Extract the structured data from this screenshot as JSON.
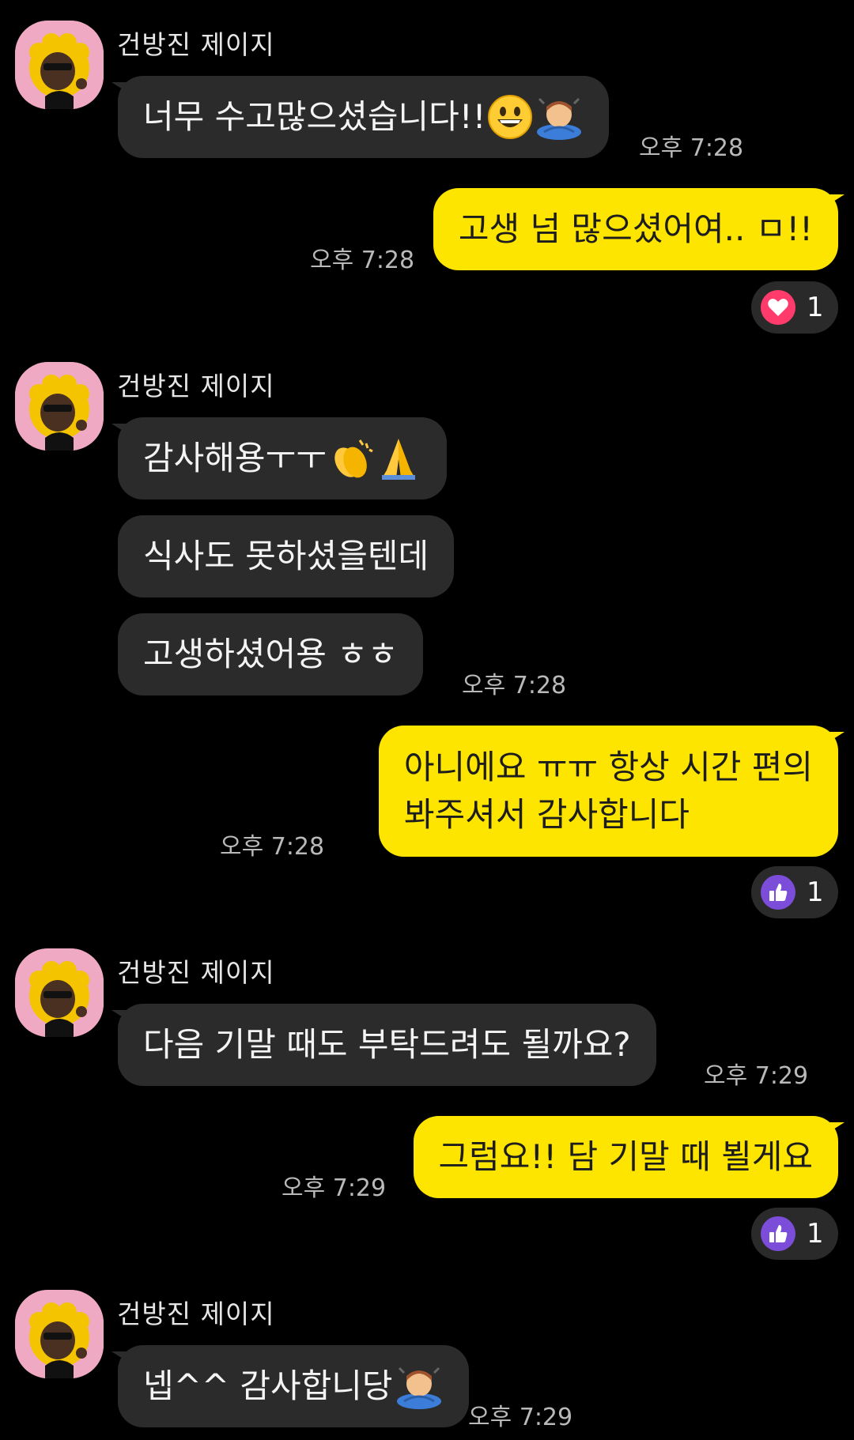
{
  "sender": {
    "name": "건방진 제이지",
    "avatar_bg": "#f0a9c2"
  },
  "colors": {
    "background": "#000000",
    "incoming_bubble": "#2b2b2b",
    "outgoing_bubble": "#fee500",
    "heart": "#ff3b6b",
    "like": "#7c4dd8"
  },
  "messages": [
    {
      "id": "m1",
      "text": "너무 수고많으셨습니다!!",
      "emojis": [
        "grinning-face",
        "person-bowing"
      ],
      "time": "오후 7:28"
    },
    {
      "id": "m2",
      "text": "고생 넘 많으셨어여.. ㅁ!!",
      "time": "오후 7:28",
      "reaction": {
        "icon": "heart-icon",
        "count": "1"
      }
    },
    {
      "id": "m3",
      "text": "감사해용ㅜㅜ",
      "emojis": [
        "clapping-hands",
        "folded-hands"
      ]
    },
    {
      "id": "m4",
      "text": "식사도 못하셨을텐데"
    },
    {
      "id": "m5",
      "text": "고생하셨어용 ㅎㅎ",
      "time": "오후 7:28"
    },
    {
      "id": "m6",
      "line1": "아니에요 ㅠㅠ 항상 시간 편의",
      "line2": "봐주셔서 감사합니다",
      "time": "오후 7:28",
      "reaction": {
        "icon": "thumbs-up-icon",
        "count": "1"
      }
    },
    {
      "id": "m7",
      "text": "다음 기말 때도 부탁드려도 될까요?",
      "time": "오후 7:29"
    },
    {
      "id": "m8",
      "text": "그럼요!! 담 기말 때 뵐게요",
      "time": "오후 7:29",
      "reaction": {
        "icon": "thumbs-up-icon",
        "count": "1"
      }
    },
    {
      "id": "m9",
      "text": "넵^^ 감사합니당",
      "emojis": [
        "person-bowing"
      ],
      "time": "오후 7:29"
    }
  ]
}
